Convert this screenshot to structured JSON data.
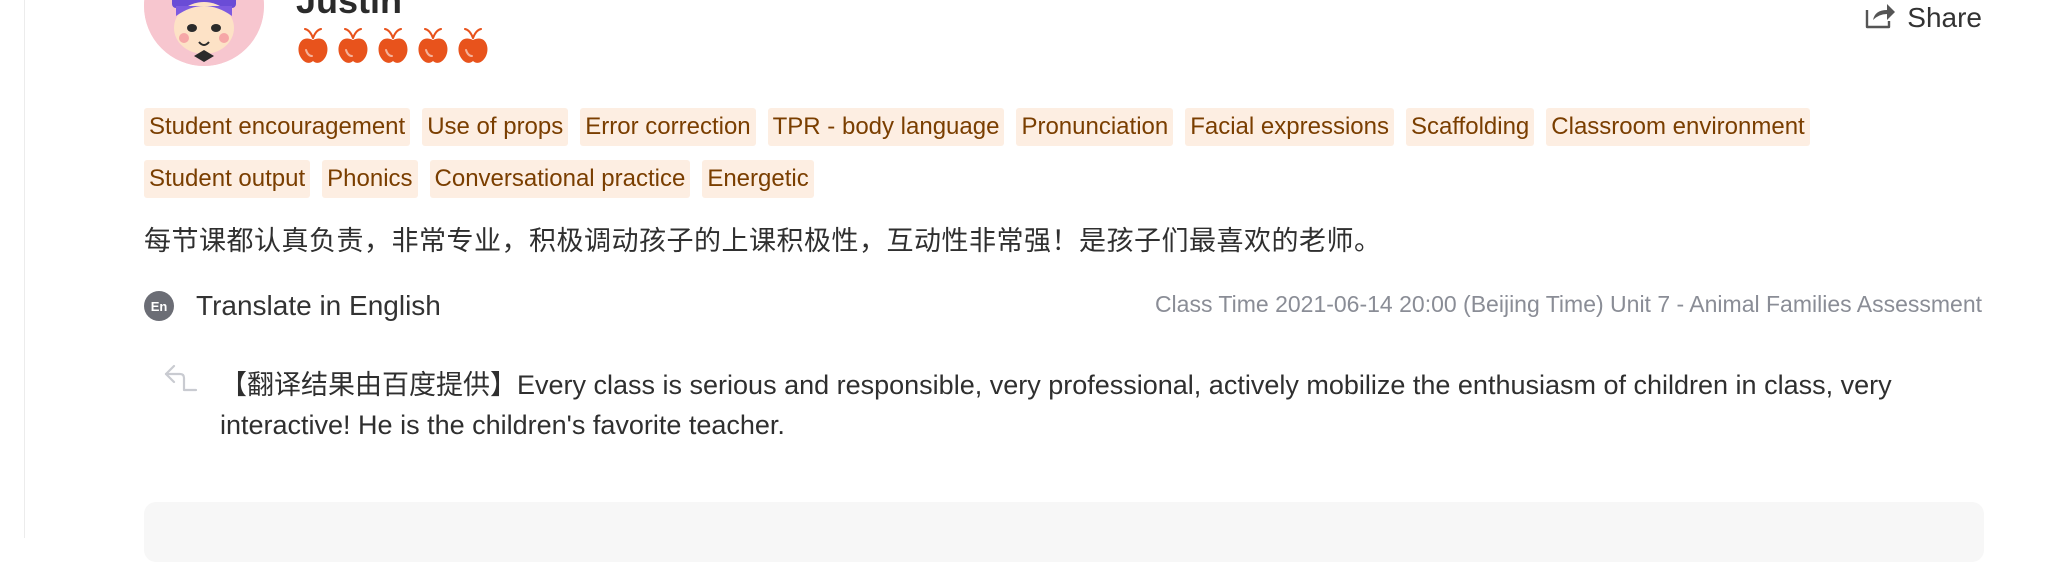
{
  "teacher": {
    "name": "Justin",
    "rating_icon": "apple-icon",
    "rating": 5
  },
  "share": {
    "label": "Share",
    "icon": "share-arrow-icon"
  },
  "tags": [
    [
      "Student encouragement",
      "Use of props",
      "Error correction",
      "TPR - body language",
      "Pronunciation",
      "Facial expressions",
      "Scaffolding",
      "Classroom environment"
    ],
    [
      "Student output",
      "Phonics",
      "Conversational practice",
      "Energetic"
    ]
  ],
  "review": {
    "text": "每节课都认真负责，非常专业，积极调动孩子的上课积极性，互动性非常强！是孩子们最喜欢的老师。"
  },
  "translate": {
    "badge": "En",
    "label": "Translate in English"
  },
  "class_info": "Class Time 2021-06-14 20:00 (Beijing Time) Unit 7 - Animal Families Assessment",
  "translation": {
    "text": "【翻译结果由百度提供】Every class is serious and responsible, very professional, actively mobilize the enthusiasm of children in class, very interactive! He is the children's favorite teacher."
  },
  "colors": {
    "tag_bg": "#fdeee2",
    "tag_text": "#7a3e00",
    "apple": "#e8531c",
    "meta_text": "#8a8d96"
  }
}
